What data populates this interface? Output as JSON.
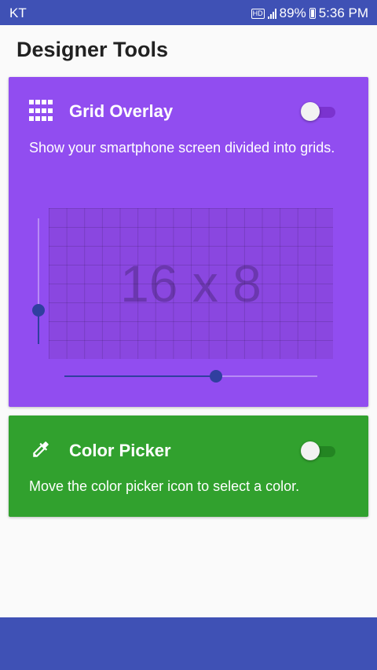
{
  "status_bar": {
    "carrier": "KT",
    "hd": "HD",
    "battery": "89%",
    "time": "5:36 PM"
  },
  "page_title": "Designer Tools",
  "grid_overlay": {
    "title": "Grid Overlay",
    "description": "Show your smartphone screen divided into grids.",
    "enabled": false,
    "columns": 16,
    "rows": 8,
    "label": "16 x 8",
    "vertical_slider_fraction": 0.27,
    "horizontal_slider_fraction": 0.6,
    "color": "#914df0"
  },
  "color_picker": {
    "title": "Color Picker",
    "description": "Move the color picker icon to select a color.",
    "enabled": false,
    "color": "#31a12e"
  },
  "colors": {
    "primary": "#3f51b5",
    "slider": "#303f9f"
  },
  "icons": {
    "grid": "grid-icon",
    "picker": "eyedropper-icon",
    "battery": "battery-icon",
    "signal": "signal-icon"
  }
}
